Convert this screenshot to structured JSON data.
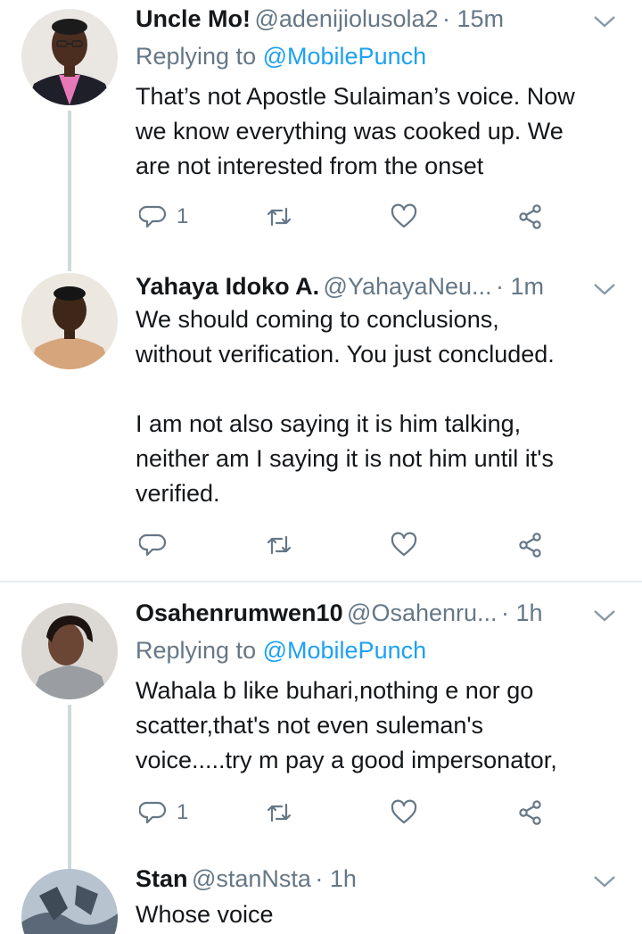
{
  "colors": {
    "link": "#1da1f2",
    "muted": "#657786",
    "text": "#14171a",
    "thread_line": "#cfd9de",
    "divider": "#e6ecf0"
  },
  "tweets": [
    {
      "name": "Uncle Mo!",
      "handle": "@adenijiolusola2",
      "time": "· 15m",
      "replying_prefix": "Replying to",
      "replying_mention": "@MobilePunch",
      "text": "That’s not Apostle Sulaiman’s voice. Now\nwe know everything was cooked up. We\nare not interested from the onset",
      "reply_count": "1",
      "icons": [
        "reply-icon",
        "retweet-icon",
        "like-icon",
        "share-icon"
      ]
    },
    {
      "name": "Yahaya Idoko A.",
      "handle": "@YahayaNeu...",
      "time": "· 1m",
      "text": "We should coming to conclusions,\nwithout verification. You just concluded.\n\nI am not also saying it is him talking,\nneither am I saying it is not him until it's\nverified.",
      "reply_count": ""
    },
    {
      "name": "Osahenrumwen10",
      "handle": "@Osahenru...",
      "time": "· 1h",
      "replying_prefix": "Replying to",
      "replying_mention": "@MobilePunch",
      "text": "Wahala b like buhari,nothing e nor go\nscatter,that's not even suleman's\nvoice.....try m pay a good impersonator,",
      "reply_count": "1"
    },
    {
      "name": "Stan",
      "handle": "@stanNsta",
      "time": "· 1h",
      "text": "Whose voice"
    }
  ]
}
